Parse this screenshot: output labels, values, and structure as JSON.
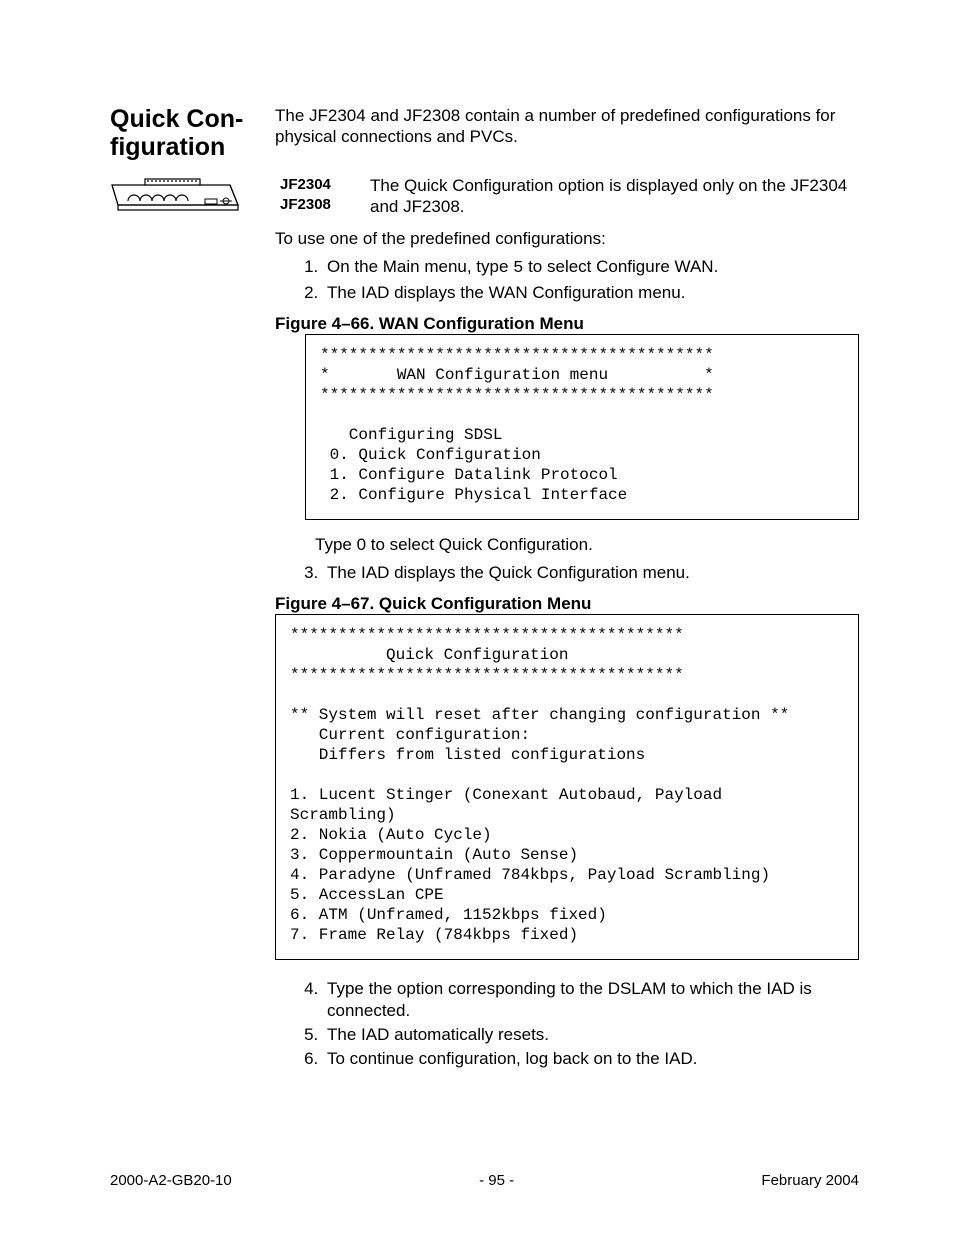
{
  "section_title_line1": "Quick Con-",
  "section_title_line2": "figuration",
  "intro": "The JF2304 and JF2308 contain a number of predefined configurations for physical connections and PVCs.",
  "note": {
    "label1": "JF2304",
    "label2": "JF2308",
    "text": "The Quick Configuration option is displayed only on the JF2304 and JF2308."
  },
  "predef_intro": "To use one of the predefined configurations:",
  "steps_a": [
    "On the Main menu, type 5 to select Configure WAN.",
    "The IAD displays the WAN Configuration menu."
  ],
  "fig66_title": "Figure 4–66.  WAN Configuration Menu",
  "fig66_code": "*****************************************\n*       WAN Configuration menu          *\n*****************************************\n\n   Configuring SDSL\n 0. Quick Configuration\n 1. Configure Datalink Protocol\n 2. Configure Physical Interface",
  "substep_2a": "Type 0 to select Quick Configuration.",
  "step3": "The IAD displays the Quick Configuration menu.",
  "fig67_title": "Figure 4–67.  Quick Configuration Menu",
  "fig67_code": "*****************************************\n          Quick Configuration\n*****************************************\n\n** System will reset after changing configuration **\n   Current configuration:\n   Differs from listed configurations\n\n1. Lucent Stinger (Conexant Autobaud, Payload\nScrambling)\n2. Nokia (Auto Cycle)\n3. Coppermountain (Auto Sense)\n4. Paradyne (Unframed 784kbps, Payload Scrambling)\n5. AccessLan CPE\n6. ATM (Unframed, 1152kbps fixed)\n7. Frame Relay (784kbps fixed)",
  "steps_b": [
    "Type the option corresponding to the DSLAM to which the IAD is connected.",
    "The IAD automatically resets.",
    "To continue configuration, log back on to the IAD."
  ],
  "footer": {
    "left": "2000-A2-GB20-10",
    "center": "- 95 -",
    "right": "February 2004"
  }
}
